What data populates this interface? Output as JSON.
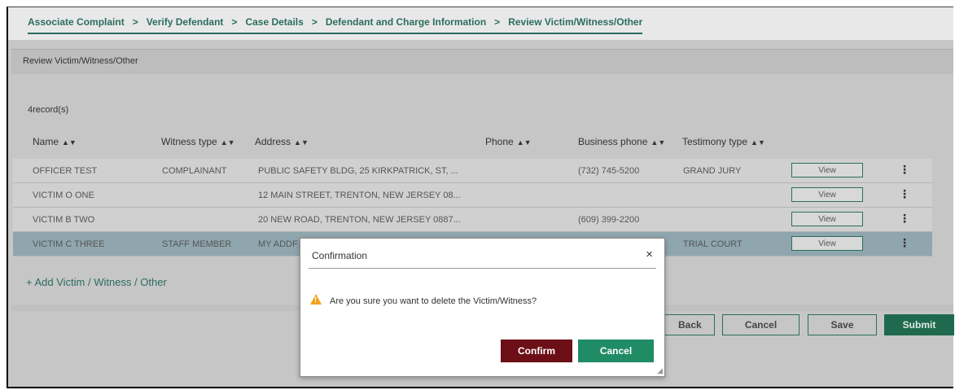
{
  "breadcrumb": [
    {
      "label": "Associate Complaint"
    },
    {
      "label": "Verify Defendant"
    },
    {
      "label": "Case Details"
    },
    {
      "label": "Defendant and Charge Information"
    },
    {
      "label": "Review Victim/Witness/Other"
    }
  ],
  "breadcrumb_separator": ">",
  "panel": {
    "title": "Review Victim/Witness/Other",
    "records": "4record(s)"
  },
  "table": {
    "headers": [
      "Name",
      "Witness type",
      "Address",
      "Phone",
      "Business phone",
      "Testimony type"
    ],
    "sort_icon": "sort-icon",
    "rows": [
      {
        "name": "OFFICER TEST",
        "witness_type": "COMPLAINANT",
        "address": "PUBLIC SAFETY BLDG, 25 KIRKPATRICK, ST, ...",
        "phone": "",
        "business_phone": "(732) 745-5200",
        "testimony_type": "GRAND JURY",
        "view": "View"
      },
      {
        "name": "VICTIM O ONE",
        "witness_type": "",
        "address": "12 MAIN STREET, TRENTON, NEW JERSEY 08...",
        "phone": "",
        "business_phone": "",
        "testimony_type": "",
        "view": "View"
      },
      {
        "name": "VICTIM B TWO",
        "witness_type": "",
        "address": "20 NEW ROAD, TRENTON, NEW JERSEY 0887...",
        "phone": "",
        "business_phone": "(609) 399-2200",
        "testimony_type": "",
        "view": "View"
      },
      {
        "name": "VICTIM C THREE",
        "witness_type": "STAFF MEMBER",
        "address": "MY ADDF",
        "phone": "",
        "business_phone": "",
        "testimony_type": "TRIAL COURT",
        "view": "View",
        "selected": true
      }
    ]
  },
  "add_link": "+ Add Victim / Witness / Other",
  "footer": {
    "back": "Back",
    "cancel": "Cancel",
    "save": "Save",
    "submit": "Submit"
  },
  "modal": {
    "title": "Confirmation",
    "close": "×",
    "message": "Are you sure you want to delete the Victim/Witness?",
    "confirm": "Confirm",
    "cancel": "Cancel"
  },
  "colors": {
    "accent": "#2b6d5e",
    "confirm": "#6c0f16",
    "cancel": "#1f8c66",
    "submit": "#1f6a4f",
    "warning": "#f0a320"
  }
}
